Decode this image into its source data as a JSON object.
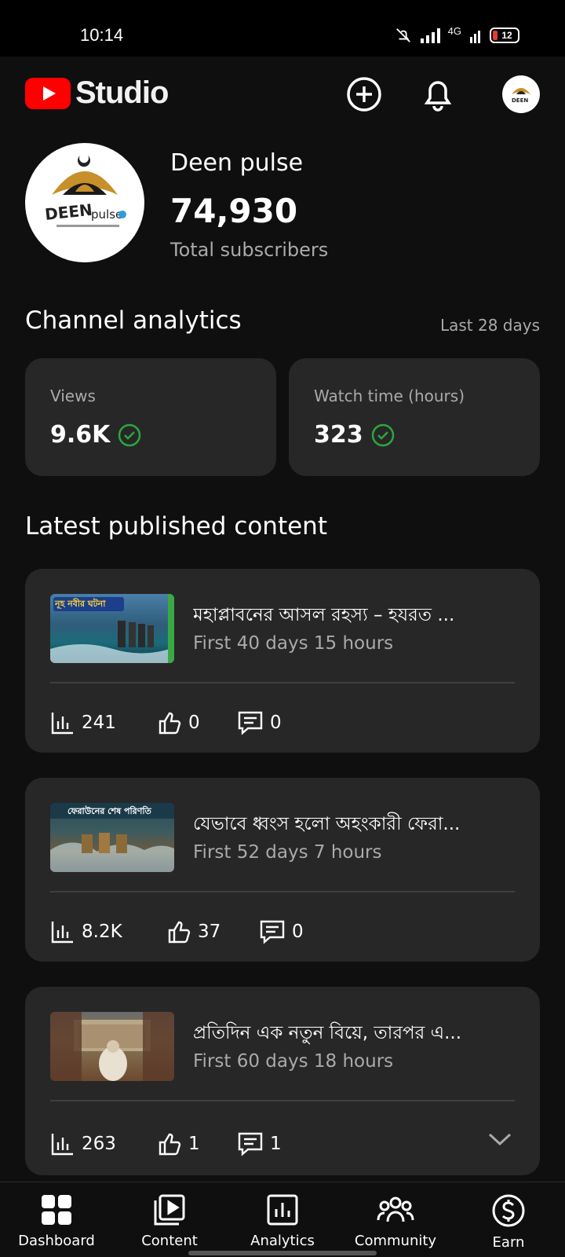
{
  "status_bar": {
    "time": "10:14",
    "network": "4G",
    "battery": "12"
  },
  "header": {
    "logo_text": "Studio"
  },
  "channel": {
    "name": "Deen pulse",
    "subscribers": "74,930",
    "subscribers_label": "Total subscribers",
    "avatar_text": "DEEN pulse"
  },
  "analytics": {
    "title": "Channel analytics",
    "period": "Last 28 days",
    "cards": [
      {
        "label": "Views",
        "value": "9.6K"
      },
      {
        "label": "Watch time (hours)",
        "value": "323"
      }
    ]
  },
  "latest": {
    "title": "Latest published content",
    "videos": [
      {
        "title": "মহাপ্লাবনের আসল রহস্য – হযরত ...",
        "age": "First 40 days 15 hours",
        "views": "241",
        "likes": "0",
        "comments": "0",
        "thumb_text": "নূহ নবীর ঘটনা"
      },
      {
        "title": "যেভাবে ধ্বংস হলো অহংকারী ফেরা...",
        "age": "First 52 days 7 hours",
        "views": "8.2K",
        "likes": "37",
        "comments": "0",
        "thumb_text": "ফেরাউনের শেষ পরিণতি"
      },
      {
        "title": "প্রতিদিন এক নতুন বিয়ে, তারপর এ...",
        "age": "First 60 days 18 hours",
        "views": "263",
        "likes": "1",
        "comments": "1",
        "thumb_text": ""
      }
    ]
  },
  "nav": {
    "items": [
      {
        "label": "Dashboard",
        "icon": "dashboard-icon"
      },
      {
        "label": "Content",
        "icon": "content-icon"
      },
      {
        "label": "Analytics",
        "icon": "analytics-icon"
      },
      {
        "label": "Community",
        "icon": "community-icon"
      },
      {
        "label": "Earn",
        "icon": "earn-icon"
      }
    ]
  },
  "colors": {
    "brand_red": "#ff0000",
    "check_green": "#2ba640",
    "card_bg": "#272727"
  }
}
